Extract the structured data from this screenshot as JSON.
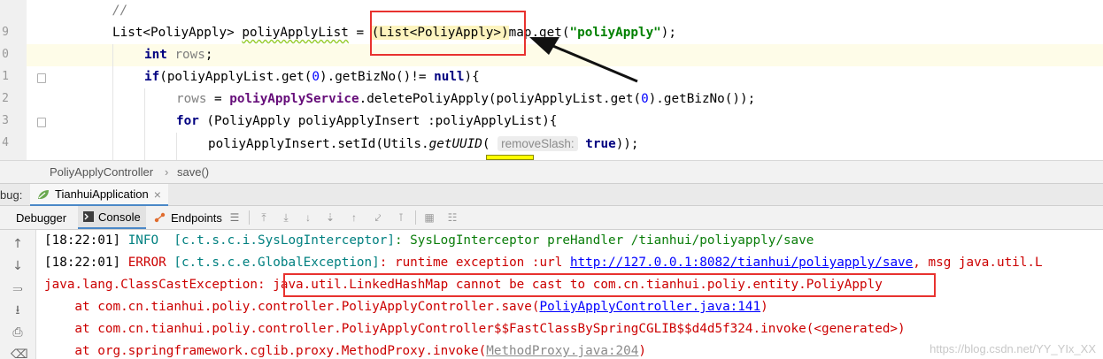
{
  "editor": {
    "line_numbers": [
      "9",
      "0",
      "1",
      "2",
      "3",
      "4"
    ],
    "comment": "//",
    "line1": {
      "type": "List<PoliyApply>",
      "var": "poliyApplyList",
      "eq": " = ",
      "cast": "(List<PoliyApply>)",
      "call_a": "map.get(",
      "arg": "\"poliyApply\"",
      "call_b": ");"
    },
    "line2": {
      "kw": "int",
      "var": "rows",
      "semi": ";"
    },
    "line3": {
      "kw": "if",
      "a": "(poliyApplyList.get(",
      "zero": "0",
      "b": ").getBizNo()!= ",
      "null": "null",
      "c": "){"
    },
    "line4": {
      "var": "rows",
      "eq": " = ",
      "service": "poliyApplyService",
      "a": ".deletePoliyApply(poliyApplyList.get(",
      "zero": "0",
      "b": ").getBizNo());"
    },
    "line5": {
      "kw": "for",
      "a": " (PoliyApply ",
      "var": "poliyApplyInsert",
      "b": " :poliyApplyList){"
    },
    "line6": {
      "a": "poliyApplyInsert.setId(Utils.",
      "method": "getUUID",
      "b": "( ",
      "hint": "removeSlash:",
      "c": " ",
      "kw": "true",
      "d": "));"
    }
  },
  "breadcrumb": {
    "class": "PoliyApplyController",
    "sep": "›",
    "method": "save()"
  },
  "debug": {
    "label": "bug:",
    "session": "TianhuiApplication",
    "close": "×"
  },
  "toolbar": {
    "debugger": "Debugger",
    "console": "Console",
    "endpoints": "Endpoints"
  },
  "console": {
    "l1": {
      "time": "[18:22:01] ",
      "level": "INFO  ",
      "logger": "[c.t.s.c.i.SysLogInterceptor]",
      "msg": ": SysLogInterceptor preHandler /tianhui/poliyapply/save"
    },
    "l2": {
      "time": "[18:22:01] ",
      "level": "ERROR ",
      "logger": "[c.t.s.c.e.GlobalException]",
      "msg": ": runtime exception :url ",
      "url": "http://127.0.0.1:8082/tianhui/poliyapply/save",
      "tail": ", msg java.util.L"
    },
    "l3": {
      "exc": "java.lang.ClassCastException: ",
      "detail": "java.util.LinkedHashMap cannot be cast to com.cn.tianhui.poliy.entity.PoliyApply"
    },
    "l4": {
      "at": "    at com.cn.tianhui.poliy.controller.PoliyApplyController.save(",
      "src": "PoliyApplyController.java:141",
      "end": ")"
    },
    "l5": {
      "at": "    at com.cn.tianhui.poliy.controller.PoliyApplyController$$FastClassBySpringCGLIB$$d4d5f324.invoke(<generated>)"
    },
    "l6": {
      "at": "    at org.springframework.cglib.proxy.MethodProxy.invoke(",
      "src": "MethodProxy.java:204",
      "end": ")"
    }
  },
  "watermark": "https://blog.csdn.net/YY_YIx_XX",
  "colors": {
    "annotation_red": "#e8322f",
    "keyword": "#000080",
    "string": "#008000"
  }
}
